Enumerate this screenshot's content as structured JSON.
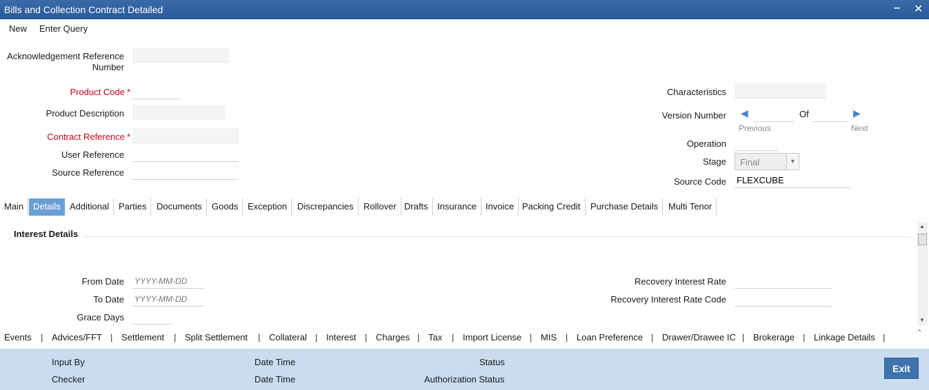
{
  "window": {
    "title": "Bills and Collection Contract Detailed",
    "minimize_icon": "minus",
    "close_icon": "x"
  },
  "menu": {
    "new": "New",
    "enter_query": "Enter Query"
  },
  "header": {
    "ack_ref_label_line1": "Acknowledgement Reference",
    "ack_ref_label_line2": "Number",
    "ack_ref_value": "",
    "product_code_label": "Product Code",
    "product_code_value": "",
    "product_description_label": "Product Description",
    "product_description_value": "",
    "contract_reference_label": "Contract Reference",
    "contract_reference_value": "",
    "user_reference_label": "User Reference",
    "user_reference_value": "",
    "source_reference_label": "Source Reference",
    "source_reference_value": "",
    "required_marker": "*",
    "characteristics_label": "Characteristics",
    "characteristics_value": "",
    "version_number_label": "Version Number",
    "version_of_label": "Of",
    "version_previous": "Previous",
    "version_next": "Next",
    "operation_label": "Operation",
    "operation_value": "",
    "stage_label": "Stage",
    "stage_value": "Final",
    "source_code_label": "Source Code",
    "source_code_value": "FLEXCUBE"
  },
  "tabs": [
    {
      "label": "Main",
      "active": false
    },
    {
      "label": "Details",
      "active": true
    },
    {
      "label": "Additional",
      "active": false
    },
    {
      "label": "Parties",
      "active": false
    },
    {
      "label": "Documents",
      "active": false
    },
    {
      "label": "Goods",
      "active": false
    },
    {
      "label": "Exception",
      "active": false
    },
    {
      "label": "Discrepancies",
      "active": false
    },
    {
      "label": "Rollover",
      "active": false
    },
    {
      "label": "Drafts",
      "active": false
    },
    {
      "label": "Insurance",
      "active": false
    },
    {
      "label": "Invoice",
      "active": false
    },
    {
      "label": "Packing Credit",
      "active": false
    },
    {
      "label": "Purchase Details",
      "active": false
    },
    {
      "label": "Multi Tenor",
      "active": false
    }
  ],
  "details": {
    "section_title": "Interest Details",
    "from_date_label": "From Date",
    "from_date_placeholder": "YYYY-MM-DD",
    "to_date_label": "To Date",
    "to_date_placeholder": "YYYY-MM-DD",
    "grace_days_label": "Grace Days",
    "recovery_interest_rate_label": "Recovery Interest Rate",
    "recovery_interest_rate_code_label": "Recovery Interest Rate Code"
  },
  "bottom_links": [
    "Events",
    "Advices/FFT",
    "Settlement",
    "Split Settlement",
    "Collateral",
    "Interest",
    "Charges",
    "Tax",
    "Import License",
    "MIS",
    "Loan Preference",
    "Drawer/Drawee IC",
    "Brokerage",
    "Linkage Details"
  ],
  "link_separator": "|",
  "footer": {
    "input_by_label": "Input By",
    "checker_label": "Checker",
    "date_time_label_1": "Date Time",
    "date_time_label_2": "Date Time",
    "status_label": "Status",
    "authorization_status_label": "Authorization Status",
    "exit_label": "Exit"
  },
  "colors": {
    "titlebar": "#295a99",
    "active_tab": "#6a9fd6",
    "required": "#d0021b",
    "footer": "#c9ddef",
    "exit_button": "#3f73ad"
  }
}
